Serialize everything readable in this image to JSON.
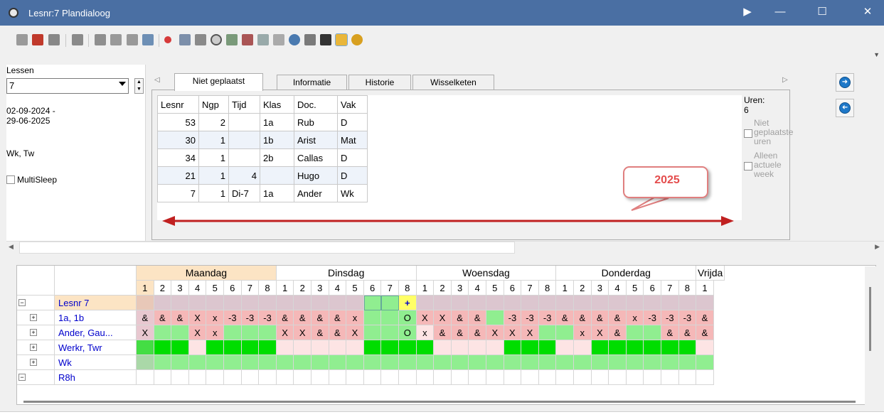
{
  "window": {
    "title": "Lesnr:7  Plandialoog",
    "controls": [
      "▶",
      "—",
      "☐",
      "✕"
    ]
  },
  "toolbar": {
    "icons": [
      "lesson-copy-icon",
      "lesson-card-icon",
      "pin-icon",
      "import-icon",
      "lesson-view-icon",
      "lock-icon",
      "people-icon",
      "wand-icon",
      "search-icon",
      "filter-list-icon",
      "teacher-icon",
      "clock-icon",
      "class-icon",
      "delete-lessons-icon",
      "lines-icon",
      "lines-alt-icon",
      "refresh-icon",
      "calculator-icon",
      "graduation-icon",
      "edit-lesson-icon",
      "gear-icon"
    ]
  },
  "left": {
    "label": "Lessen",
    "combo_value": "7",
    "dates": "02-09-2024 -\n29-06-2025",
    "wk": "Wk, Tw",
    "multisleep": "MultiSleep"
  },
  "tabs": [
    "Niet geplaatst",
    "Informatie",
    "Historie",
    "Wisselketen"
  ],
  "table": {
    "headers": [
      "Lesnr",
      "Ngp",
      "Tijd",
      "Klas",
      "Doc.",
      "Vak"
    ],
    "rows": [
      [
        "53",
        "2",
        "",
        "1a",
        "Rub",
        "D"
      ],
      [
        "30",
        "1",
        "",
        "1b",
        "Arist",
        "Mat"
      ],
      [
        "34",
        "1",
        "",
        "2b",
        "Callas",
        "D"
      ],
      [
        "21",
        "1",
        "4",
        "",
        "Hugo",
        "D"
      ],
      [
        "7",
        "1",
        "Di-7",
        "1a",
        "Ander",
        "Wk"
      ]
    ]
  },
  "uren": {
    "label": "Uren:",
    "value": "6",
    "niet": "Niet\ngeplaatste\nuren",
    "alleen": "Alleen\nactuele\nweek"
  },
  "callout": "2025",
  "schedule": {
    "days": [
      "Maandag",
      "Dinsdag",
      "Woensdag",
      "Donderdag",
      "Vrijda"
    ],
    "rows": [
      {
        "label": "Lesnr 7",
        "tree": "⊟"
      },
      {
        "label": "1a, 1b",
        "tree": "⊞"
      },
      {
        "label": "Ander, Gau...",
        "tree": "⊞"
      },
      {
        "label": "Werkr, Twr",
        "tree": "⊞"
      },
      {
        "label": "Wk",
        "tree": "⊞"
      },
      {
        "label": "R8h",
        "tree": "⊟"
      }
    ],
    "cells_1a": [
      "&",
      "&",
      "&",
      "X",
      "x",
      "-3",
      "-3",
      "-3",
      "&",
      "&",
      "&",
      "&",
      "x",
      "",
      "",
      "O",
      "X",
      "X",
      "&",
      "&",
      "",
      "-3",
      "-3",
      "-3",
      "&",
      "&",
      "&",
      "&",
      "x",
      "-3",
      "-3",
      "-3",
      "&"
    ],
    "cells_ander": [
      "X",
      "",
      "",
      "X",
      "x",
      "",
      "",
      "",
      "X",
      "X",
      "&",
      "&",
      "X",
      "",
      "",
      "O",
      "x",
      "&",
      "&",
      "&",
      "X",
      "X",
      "X",
      "",
      "",
      "x",
      "X",
      "&",
      "",
      "",
      "&",
      "&",
      "&"
    ]
  },
  "colors": {
    "title": "#4a6fa3",
    "pink": "#f5b8b8",
    "green": "#90ee90",
    "bright": "#00dd00",
    "lightpink": "#fde4e4",
    "mauve": "#dcc6cf"
  }
}
